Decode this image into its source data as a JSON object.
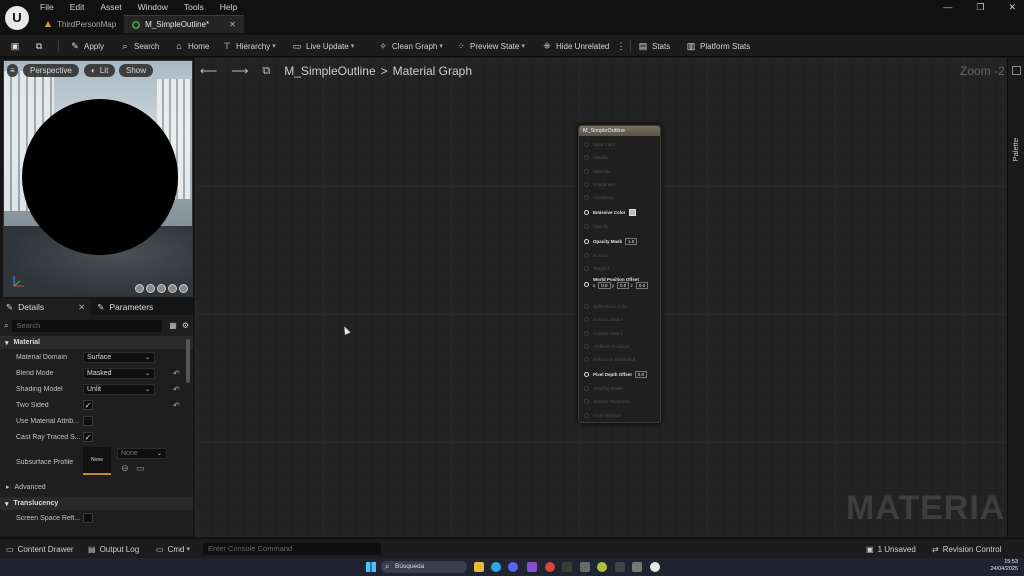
{
  "app": {
    "logo_text": "U",
    "menu": [
      "File",
      "Edit",
      "Asset",
      "Window",
      "Tools",
      "Help"
    ],
    "tabs": [
      {
        "label": "ThirdPersonMap",
        "active": false
      },
      {
        "label": "M_SimpleOutline*",
        "active": true
      }
    ],
    "window_controls": [
      "—",
      "❐",
      "✕"
    ]
  },
  "toolbar": {
    "apply": "Apply",
    "search": "Search",
    "home": "Home",
    "hierarchy": "Hierarchy",
    "live_update": "Live Update",
    "clean_graph": "Clean Graph",
    "preview_state": "Preview State",
    "hide_unrelated": "Hide Unrelated",
    "stats": "Stats",
    "platform_stats": "Platform Stats"
  },
  "viewport": {
    "perspective": "Perspective",
    "lit": "Lit",
    "show": "Show"
  },
  "details": {
    "tab_details": "Details",
    "tab_parameters": "Parameters",
    "search_placeholder": "Search",
    "section_material": "Material",
    "rows": [
      {
        "label": "Material Domain",
        "value": "Surface",
        "type": "dropdown",
        "reset": false
      },
      {
        "label": "Blend Mode",
        "value": "Masked",
        "type": "dropdown",
        "reset": true
      },
      {
        "label": "Shading Model",
        "value": "Unlit",
        "type": "dropdown",
        "reset": true
      },
      {
        "label": "Two Sided",
        "checked": true,
        "type": "checkbox",
        "reset": true
      },
      {
        "label": "Use Material Attrib...",
        "checked": false,
        "type": "checkbox",
        "reset": false
      },
      {
        "label": "Cast Ray Traced S...",
        "checked": true,
        "type": "checkbox",
        "reset": false
      }
    ],
    "subsurface_label": "Subsurface Profile",
    "subsurface_thumb": "None",
    "subsurface_value": "None",
    "section_advanced": "Advanced",
    "section_translucency": "Translucency",
    "screen_space_label": "Screen Space Refl..."
  },
  "graph": {
    "breadcrumb_asset": "M_SimpleOutline",
    "breadcrumb_sep": ">",
    "breadcrumb_graph": "Material Graph",
    "zoom": "Zoom -2",
    "watermark": "MATERIAL",
    "palette": "Palette",
    "node": {
      "title": "M_SimpleOutline",
      "pins": [
        {
          "label": "Base Color",
          "active": false
        },
        {
          "label": "Metallic",
          "active": false
        },
        {
          "label": "Specular",
          "active": false
        },
        {
          "label": "Roughness",
          "active": false
        },
        {
          "label": "Anisotropy",
          "active": false
        },
        {
          "label": "Emissive Color",
          "active": true,
          "swatch": true
        },
        {
          "label": "Opacity",
          "active": false
        },
        {
          "label": "Opacity Mask",
          "active": true,
          "value": "1.0"
        },
        {
          "label": "Normal",
          "active": false
        },
        {
          "label": "Tangent",
          "active": false
        },
        {
          "label": "World Position Offset",
          "active": true,
          "vec": [
            "0.0",
            "0.0",
            "0.0"
          ]
        },
        {
          "label": "Subsurface Color",
          "active": false
        },
        {
          "label": "Custom Data 0",
          "active": false
        },
        {
          "label": "Custom Data 1",
          "active": false
        },
        {
          "label": "Ambient Occlusion",
          "active": false
        },
        {
          "label": "Refraction (Disabled)",
          "active": false
        },
        {
          "label": "Pixel Depth Offset",
          "active": true,
          "value": "0.0"
        },
        {
          "label": "Shading Model",
          "active": false
        },
        {
          "label": "Surface Thickness",
          "active": false
        },
        {
          "label": "Front Material",
          "active": false
        }
      ]
    }
  },
  "statusbar": {
    "content_drawer": "Content Drawer",
    "output_log": "Output Log",
    "cmd": "Cmd",
    "console_placeholder": "Enter Console Command",
    "unsaved": "1 Unsaved",
    "revision_control": "Revision Control"
  },
  "taskbar": {
    "search": "Búsqueda",
    "time": "15:53",
    "date": "24/04/2025"
  },
  "colors": {
    "graph_bg": "#232323",
    "node_header": "#6e655b",
    "check": "#e0e0e0"
  }
}
